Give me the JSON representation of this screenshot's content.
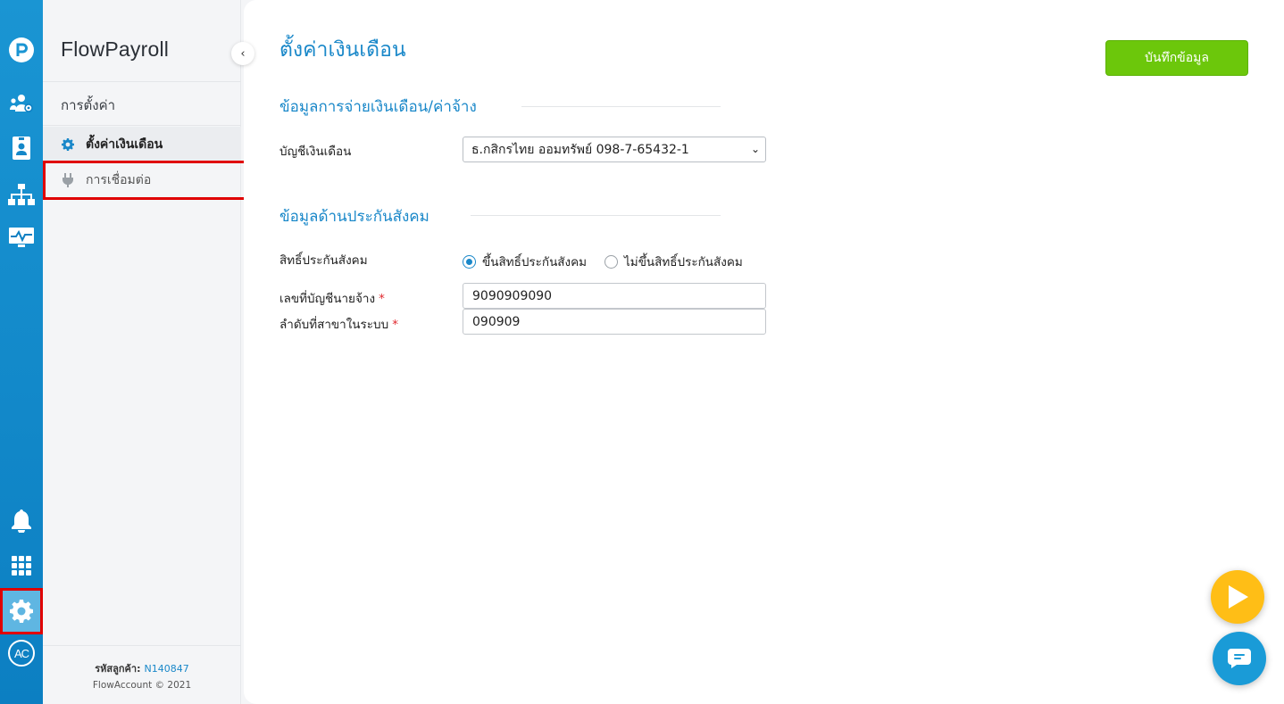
{
  "app": {
    "brand": "FlowPayroll"
  },
  "rail": {
    "icons": [
      "logo-icon",
      "employees-icon",
      "id-card-icon",
      "org-chart-icon",
      "monitor-icon",
      "bell-icon",
      "apps-grid-icon",
      "gear-icon",
      "avatar"
    ],
    "avatar_initials": "AC",
    "accent": "#1a95d3"
  },
  "sidebar": {
    "section_label": "การตั้งค่า",
    "items": [
      {
        "label": "ตั้งค่าเงินเดือน",
        "icon": "gear-icon",
        "active": true
      },
      {
        "label": "การเชื่อมต่อ",
        "icon": "plug-icon",
        "active": false
      }
    ],
    "customer_code_label": "รหัสลูกค้า:",
    "customer_code": "N140847",
    "copyright": "FlowAccount © 2021"
  },
  "main": {
    "title": "ตั้งค่าเงินเดือน",
    "save_label": "บันทึกข้อมูล",
    "payment_section": {
      "title": "ข้อมูลการจ่ายเงินเดือน/ค่าจ้าง",
      "account_label": "บัญชีเงินเดือน",
      "account_value": "ธ.กสิกรไทย ออมทรัพย์ 098-7-65432-1"
    },
    "social_section": {
      "title": "ข้อมูลด้านประกันสังคม",
      "right_label": "สิทธิ์ประกันสังคม",
      "radio_on_label": "ขึ้นสิทธิ์ประกันสังคม",
      "radio_off_label": "ไม่ขึ้นสิทธิ์ประกันสังคม",
      "radio_selected": "on",
      "employer_account_label": "เลขที่บัญชีนายจ้าง",
      "employer_account_value": "9090909090",
      "branch_label": "ลำดับที่สาขาในระบบ",
      "branch_value": "090909",
      "required_mark": "*"
    }
  },
  "colors": {
    "primary": "#1a88c9",
    "save": "#6cc70b",
    "highlight": "#e00000",
    "play": "#ffbe16"
  }
}
